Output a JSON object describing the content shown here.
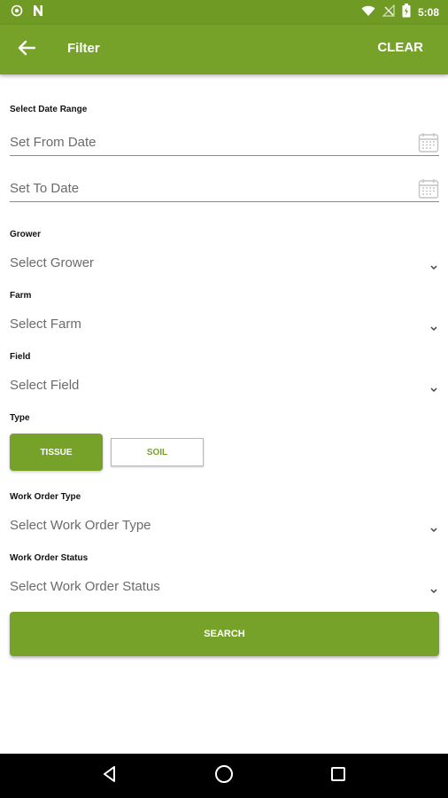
{
  "status_bar": {
    "time": "5:08"
  },
  "app_bar": {
    "title": "Filter",
    "clear_label": "CLEAR"
  },
  "date_range": {
    "label": "Select Date Range",
    "from_placeholder": "Set From Date",
    "to_placeholder": "Set To Date"
  },
  "grower": {
    "label": "Grower",
    "placeholder": "Select Grower"
  },
  "farm": {
    "label": "Farm",
    "placeholder": "Select Farm"
  },
  "field": {
    "label": "Field",
    "placeholder": "Select Field"
  },
  "type": {
    "label": "Type",
    "options": [
      "TISSUE",
      "SOIL"
    ],
    "selected": "TISSUE"
  },
  "work_order_type": {
    "label": "Work Order Type",
    "placeholder": "Select Work Order Type"
  },
  "work_order_status": {
    "label": "Work Order Status",
    "placeholder": "Select Work Order Status"
  },
  "search": {
    "label": "SEARCH"
  },
  "colors": {
    "primary": "#77a22a",
    "status_bar": "#6f9a24",
    "nav_bar": "#000000"
  }
}
